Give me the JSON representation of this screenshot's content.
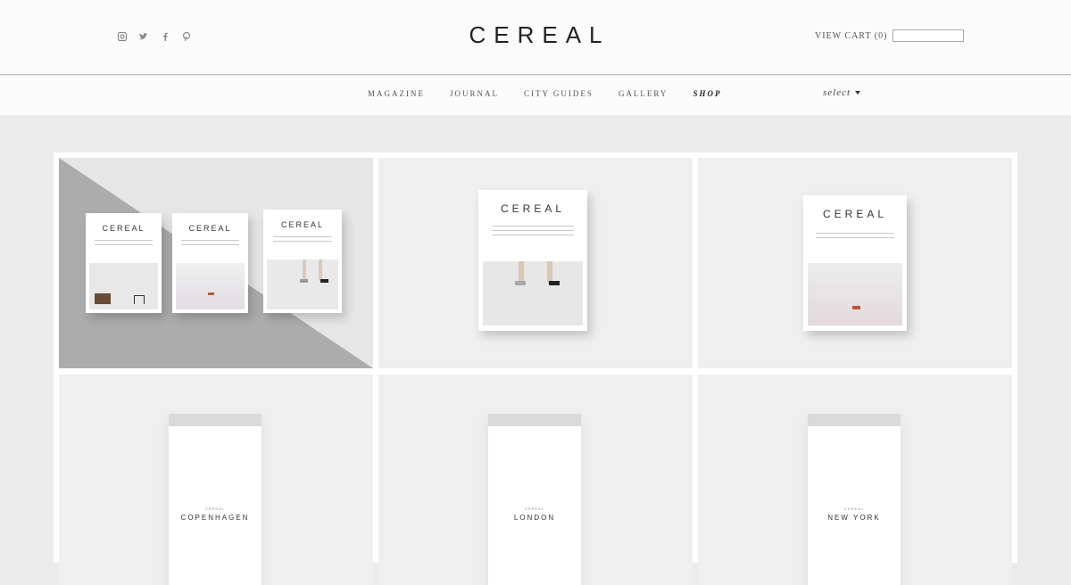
{
  "header": {
    "logo": "CEREAL",
    "social": [
      "instagram-icon",
      "twitter-icon",
      "facebook-icon",
      "pinterest-icon"
    ],
    "cart_label": "VIEW CART (0)"
  },
  "nav": {
    "items": [
      {
        "label": "MAGAZINE"
      },
      {
        "label": "JOURNAL"
      },
      {
        "label": "CITY GUIDES"
      },
      {
        "label": "GALLERY"
      },
      {
        "label": "SHOP",
        "active": true
      }
    ],
    "select_label": "select"
  },
  "products": {
    "magazine_logo": "CEREAL",
    "guides": [
      {
        "brand": "CEREAL",
        "city": "COPENHAGEN"
      },
      {
        "brand": "CEREAL",
        "city": "LONDON"
      },
      {
        "brand": "CEREAL",
        "city": "NEW YORK"
      }
    ]
  },
  "colors": {
    "page_bg": "#ebebeb",
    "header_bg": "#fbfbfb",
    "diagonal_grey": "#a9a9a9"
  }
}
